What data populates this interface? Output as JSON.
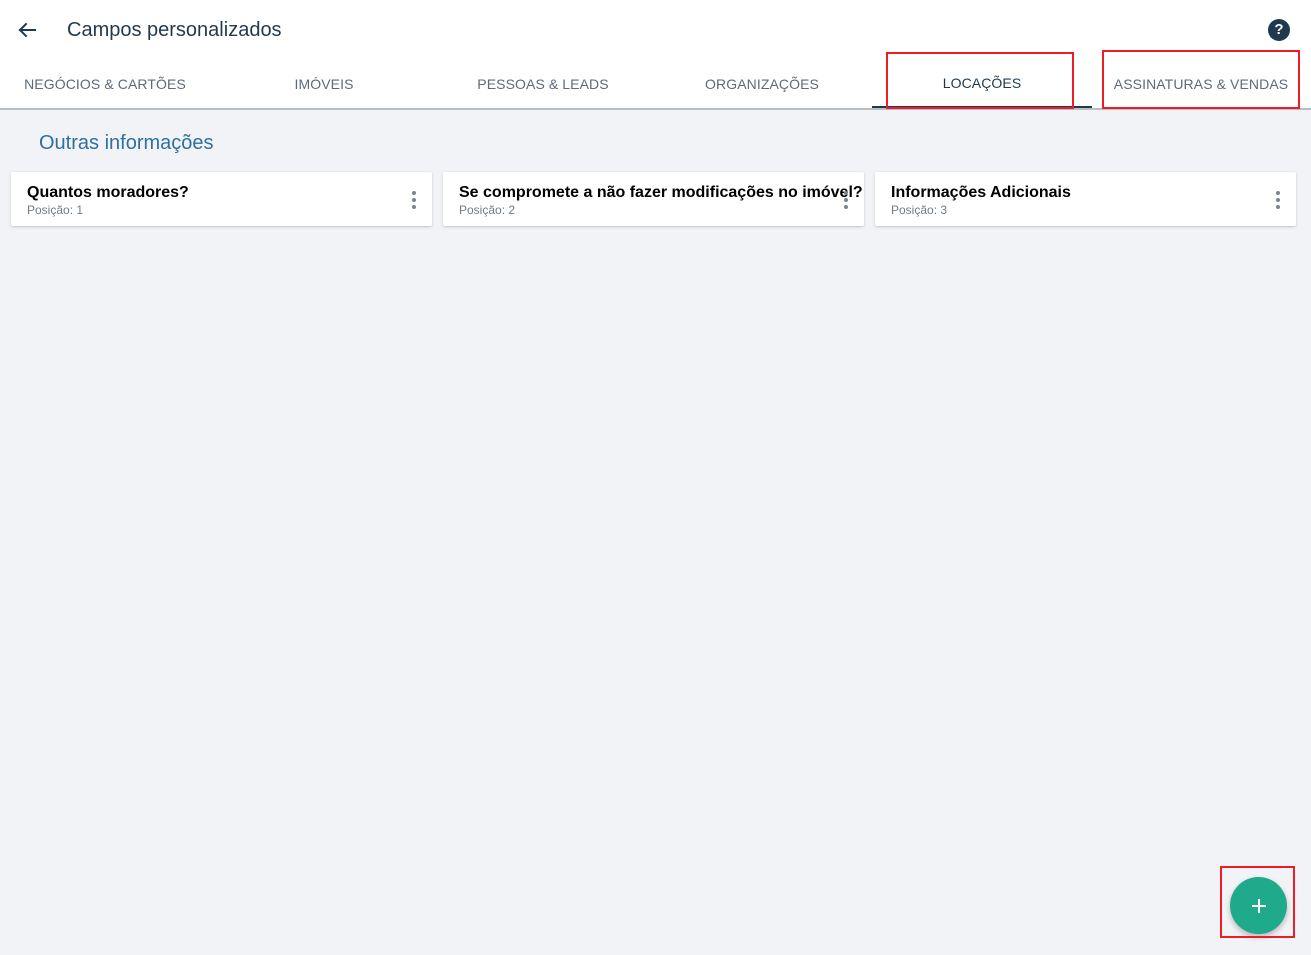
{
  "header": {
    "title": "Campos personalizados",
    "back_icon": "arrow-left-icon",
    "help_icon": "help-circle-icon",
    "help_glyph": "?"
  },
  "tabs": [
    {
      "label": "NEGÓCIOS & CARTÕES",
      "active": false
    },
    {
      "label": "IMÓVEIS",
      "active": false
    },
    {
      "label": "PESSOAS & LEADS",
      "active": false
    },
    {
      "label": "ORGANIZAÇÕES",
      "active": false
    },
    {
      "label": "LOCAÇÕES",
      "active": true
    },
    {
      "label": "ASSINATURAS & VENDAS",
      "active": false
    }
  ],
  "section": {
    "title": "Outras informações"
  },
  "cards": [
    {
      "title": "Quantos moradores?",
      "position": "Posição: 1"
    },
    {
      "title": "Se compromete a não fazer modificações no imóvel?",
      "position": "Posição: 2"
    },
    {
      "title": "Informações Adicionais",
      "position": "Posição: 3"
    }
  ],
  "fab": {
    "icon": "plus-icon"
  },
  "colors": {
    "primary_dark": "#1f3a4f",
    "section_title": "#2f6fa1",
    "fab": "#1faa8c",
    "highlight": "#ee1c24",
    "background": "#f2f3f7"
  }
}
